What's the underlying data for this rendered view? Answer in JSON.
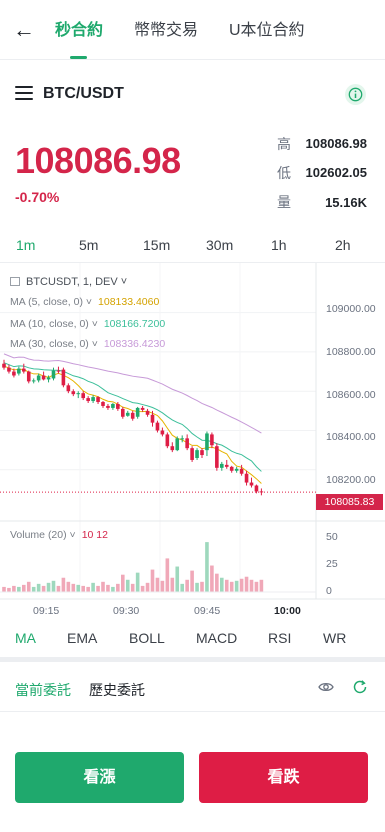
{
  "nav": {
    "back_icon": "arrow-left-icon",
    "tabs": [
      "秒合約",
      "幣幣交易",
      "U本位合約"
    ],
    "active_tab": 0
  },
  "symbol": {
    "name": "BTC/USDT",
    "menu_icon": "hamburger-menu-icon",
    "info_icon": "info-icon"
  },
  "ticker": {
    "last_price": "108086.98",
    "change_pct": "-0.70%",
    "high_label": "高",
    "high": "108086.98",
    "low_label": "低",
    "low": "102602.05",
    "vol_label": "量",
    "volume": "15.16K"
  },
  "timeframes": [
    "1m",
    "5m",
    "15m",
    "30m",
    "1h",
    "2h"
  ],
  "active_timeframe": 0,
  "chart_legend": {
    "symbol": "BTCUSDT, 1, DEV",
    "ma5_label": "MA (5, close, 0)",
    "ma5_value": "108133.4060",
    "ma10_label": "MA (10, close, 0)",
    "ma10_value": "108166.7200",
    "ma30_label": "MA (30, close, 0)",
    "ma30_value": "108336.4230",
    "volume_label": "Volume (20)",
    "volume_value": "10 12"
  },
  "chart_data": {
    "type": "candlestick",
    "symbol": "BTCUSDT",
    "interval": "1m",
    "y_ticks": [
      "109000.00",
      "108800.00",
      "108600.00",
      "108400.00",
      "108200.00"
    ],
    "ylim": [
      107980,
      109100
    ],
    "current_price_tag": "108085.83",
    "x_ticks": [
      "09:15",
      "09:30",
      "09:45",
      "10:00"
    ],
    "volume_ticks": [
      "50",
      "25",
      "0"
    ],
    "volume_ylim": [
      0,
      55
    ],
    "candles": [
      {
        "o": 108740,
        "h": 108760,
        "l": 108710,
        "c": 108720
      },
      {
        "o": 108720,
        "h": 108735,
        "l": 108690,
        "c": 108700
      },
      {
        "o": 108700,
        "h": 108715,
        "l": 108670,
        "c": 108680
      },
      {
        "o": 108690,
        "h": 108725,
        "l": 108680,
        "c": 108715
      },
      {
        "o": 108715,
        "h": 108740,
        "l": 108690,
        "c": 108700
      },
      {
        "o": 108700,
        "h": 108705,
        "l": 108640,
        "c": 108650
      },
      {
        "o": 108650,
        "h": 108665,
        "l": 108640,
        "c": 108655
      },
      {
        "o": 108655,
        "h": 108690,
        "l": 108645,
        "c": 108680
      },
      {
        "o": 108680,
        "h": 108700,
        "l": 108655,
        "c": 108660
      },
      {
        "o": 108660,
        "h": 108680,
        "l": 108645,
        "c": 108670
      },
      {
        "o": 108665,
        "h": 108720,
        "l": 108655,
        "c": 108705
      },
      {
        "o": 108705,
        "h": 108725,
        "l": 108690,
        "c": 108700
      },
      {
        "o": 108710,
        "h": 108720,
        "l": 108620,
        "c": 108630
      },
      {
        "o": 108630,
        "h": 108640,
        "l": 108590,
        "c": 108600
      },
      {
        "o": 108600,
        "h": 108610,
        "l": 108575,
        "c": 108585
      },
      {
        "o": 108585,
        "h": 108600,
        "l": 108565,
        "c": 108590
      },
      {
        "o": 108590,
        "h": 108600,
        "l": 108555,
        "c": 108565
      },
      {
        "o": 108565,
        "h": 108575,
        "l": 108540,
        "c": 108550
      },
      {
        "o": 108550,
        "h": 108580,
        "l": 108540,
        "c": 108570
      },
      {
        "o": 108570,
        "h": 108575,
        "l": 108535,
        "c": 108545
      },
      {
        "o": 108545,
        "h": 108550,
        "l": 108515,
        "c": 108525
      },
      {
        "o": 108525,
        "h": 108535,
        "l": 108505,
        "c": 108515
      },
      {
        "o": 108515,
        "h": 108540,
        "l": 108505,
        "c": 108535
      },
      {
        "o": 108535,
        "h": 108545,
        "l": 108500,
        "c": 108510
      },
      {
        "o": 108510,
        "h": 108520,
        "l": 108460,
        "c": 108470
      },
      {
        "o": 108475,
        "h": 108500,
        "l": 108470,
        "c": 108490
      },
      {
        "o": 108490,
        "h": 108500,
        "l": 108450,
        "c": 108460
      },
      {
        "o": 108470,
        "h": 108520,
        "l": 108460,
        "c": 108515
      },
      {
        "o": 108515,
        "h": 108525,
        "l": 108495,
        "c": 108505
      },
      {
        "o": 108500,
        "h": 108510,
        "l": 108470,
        "c": 108480
      },
      {
        "o": 108480,
        "h": 108500,
        "l": 108420,
        "c": 108440
      },
      {
        "o": 108440,
        "h": 108450,
        "l": 108390,
        "c": 108400
      },
      {
        "o": 108400,
        "h": 108415,
        "l": 108370,
        "c": 108380
      },
      {
        "o": 108380,
        "h": 108390,
        "l": 108310,
        "c": 108320
      },
      {
        "o": 108320,
        "h": 108340,
        "l": 108290,
        "c": 108300
      },
      {
        "o": 108300,
        "h": 108370,
        "l": 108295,
        "c": 108360
      },
      {
        "o": 108355,
        "h": 108375,
        "l": 108340,
        "c": 108360
      },
      {
        "o": 108360,
        "h": 108380,
        "l": 108300,
        "c": 108310
      },
      {
        "o": 108310,
        "h": 108320,
        "l": 108240,
        "c": 108250
      },
      {
        "o": 108260,
        "h": 108310,
        "l": 108250,
        "c": 108300
      },
      {
        "o": 108300,
        "h": 108310,
        "l": 108260,
        "c": 108275
      },
      {
        "o": 108300,
        "h": 108395,
        "l": 108270,
        "c": 108385
      },
      {
        "o": 108380,
        "h": 108390,
        "l": 108310,
        "c": 108325
      },
      {
        "o": 108320,
        "h": 108335,
        "l": 108195,
        "c": 108210
      },
      {
        "o": 108210,
        "h": 108240,
        "l": 108195,
        "c": 108230
      },
      {
        "o": 108225,
        "h": 108250,
        "l": 108205,
        "c": 108215
      },
      {
        "o": 108215,
        "h": 108220,
        "l": 108185,
        "c": 108195
      },
      {
        "o": 108195,
        "h": 108215,
        "l": 108185,
        "c": 108205
      },
      {
        "o": 108205,
        "h": 108225,
        "l": 108170,
        "c": 108180
      },
      {
        "o": 108180,
        "h": 108195,
        "l": 108120,
        "c": 108135
      },
      {
        "o": 108135,
        "h": 108160,
        "l": 108110,
        "c": 108120
      },
      {
        "o": 108120,
        "h": 108125,
        "l": 108080,
        "c": 108090
      },
      {
        "o": 108090,
        "h": 108105,
        "l": 108070,
        "c": 108086
      }
    ],
    "volumes": [
      5,
      4,
      6,
      5,
      7,
      10,
      5,
      8,
      6,
      9,
      11,
      6,
      14,
      10,
      8,
      7,
      6,
      5,
      9,
      6,
      10,
      7,
      5,
      8,
      17,
      12,
      8,
      19,
      6,
      9,
      22,
      14,
      11,
      33,
      14,
      25,
      8,
      12,
      21,
      9,
      10,
      49,
      26,
      18,
      14,
      12,
      10,
      11,
      13,
      15,
      12,
      10,
      12
    ]
  },
  "indicators": [
    "MA",
    "EMA",
    "BOLL",
    "MACD",
    "RSI",
    "WR"
  ],
  "active_indicator": 0,
  "orders": {
    "current_tab": "當前委託",
    "history_tab": "歷史委託",
    "eye_icon": "eye-icon",
    "refresh_icon": "refresh-icon"
  },
  "actions": {
    "long_label": "看漲",
    "short_label": "看跌"
  },
  "colors": {
    "accent": "#1fa96d",
    "down": "#de1d45",
    "ma5": "#e6b400",
    "ma10": "#3cbf9a",
    "ma30": "#c79ad8"
  }
}
